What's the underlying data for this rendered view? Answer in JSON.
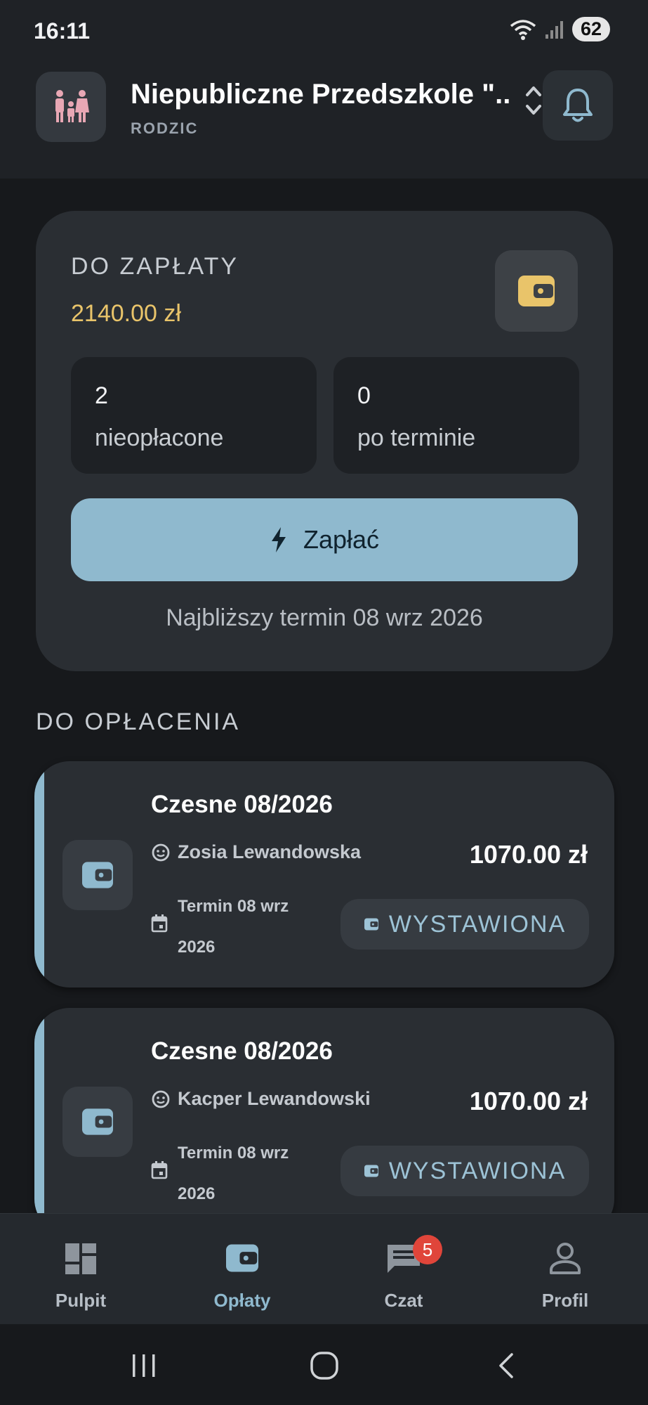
{
  "status_bar": {
    "time": "16:11",
    "battery": "62"
  },
  "header": {
    "org_name": "Niepubliczne Przedszkole \"...",
    "role": "RODZIC"
  },
  "summary": {
    "label": "DO ZAPŁATY",
    "amount": "2140.00 zł",
    "unpaid_count": "2",
    "unpaid_label": "nieopłacone",
    "overdue_count": "0",
    "overdue_label": "po terminie",
    "pay_button": "Zapłać",
    "next_due": "Najbliższy termin 08 wrz 2026"
  },
  "section_title": "DO OPŁACENIA",
  "fees": [
    {
      "title": "Czesne 08/2026",
      "child": "Zosia Lewandowska",
      "amount": "1070.00 zł",
      "due": "Termin 08 wrz 2026",
      "status": "WYSTAWIONA"
    },
    {
      "title": "Czesne 08/2026",
      "child": "Kacper Lewandowski",
      "amount": "1070.00 zł",
      "due": "Termin 08 wrz 2026",
      "status": "WYSTAWIONA"
    }
  ],
  "nav": [
    {
      "label": "Pulpit",
      "icon": "dashboard-icon"
    },
    {
      "label": "Opłaty",
      "icon": "wallet-icon",
      "active": true
    },
    {
      "label": "Czat",
      "icon": "chat-icon",
      "badge": "5"
    },
    {
      "label": "Profil",
      "icon": "person-icon"
    }
  ],
  "colors": {
    "accent": "#8fb9ce",
    "amount_gold": "#e9c46a",
    "badge_red": "#e0453a",
    "card_bg": "#2a2e33",
    "page_bg": "#17191c"
  }
}
